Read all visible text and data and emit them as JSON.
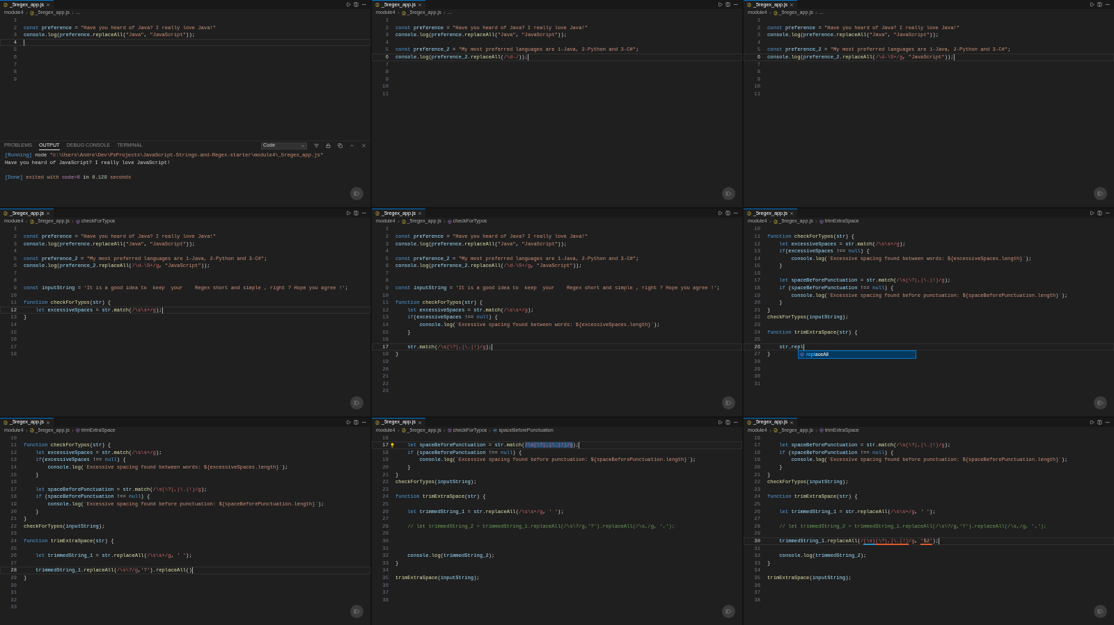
{
  "panels": [
    {
      "tab": {
        "label": "_5regex_app.js"
      },
      "breadcrumb": [
        {
          "kind": "folder",
          "text": "module4"
        },
        {
          "kind": "file",
          "text": "_5regex_app.js"
        },
        {
          "kind": "more",
          "text": "..."
        }
      ],
      "lines": [
        {
          "number": "1",
          "current": false
        },
        {
          "number": "2",
          "current": false,
          "text": "const preference = \"Have you heard of Java? I really love Java!\""
        },
        {
          "number": "3",
          "current": false,
          "text": "console.log(preference.replaceAll(\"Java\", \"JavaScript\"));"
        },
        {
          "number": "4",
          "current": true
        },
        {
          "number": "5",
          "current": false
        },
        {
          "number": "6",
          "current": false
        },
        {
          "number": "7",
          "current": false
        },
        {
          "number": "8",
          "current": false
        },
        {
          "number": "9",
          "current": false
        }
      ],
      "output": {
        "tabs": [
          {
            "label": "PROBLEMS",
            "selected": false
          },
          {
            "label": "OUTPUT",
            "selected": true
          },
          {
            "label": "DEBUG CONSOLE",
            "selected": false
          },
          {
            "label": "TERMINAL",
            "selected": false
          }
        ],
        "channel": "Code",
        "lines": [
          {
            "kind": "text",
            "parts": [
              {
                "kind": "tag",
                "text": "[Running]"
              },
              {
                "kind": "plain",
                "text": " node "
              },
              {
                "kind": "string",
                "text": "\"c:\\Users\\Andre\\Dev\\PsProjects\\JavaScript-Strings-and-Regex-starter\\module4\\_5regex_app.js\""
              }
            ]
          },
          {
            "kind": "text",
            "parts": [
              {
                "kind": "plain",
                "text": "Have you heard of JavaScript? I really love JavaScript!"
              }
            ]
          },
          {
            "kind": "blank"
          },
          {
            "kind": "text",
            "parts": [
              {
                "kind": "tag",
                "text": "[Done]"
              },
              {
                "kind": "string",
                "text": " exited with "
              },
              {
                "kind": "keyword",
                "text": "code=0"
              },
              {
                "kind": "plain",
                "text": " in "
              },
              {
                "kind": "number",
                "text": "0.129"
              },
              {
                "kind": "string",
                "text": " seconds"
              }
            ]
          }
        ]
      }
    },
    {
      "tab": {
        "label": "_5regex_app.js"
      },
      "breadcrumb": [
        {
          "kind": "folder",
          "text": "module4"
        },
        {
          "kind": "file",
          "text": "_5regex_app.js"
        },
        {
          "kind": "more",
          "text": "..."
        }
      ],
      "lines": [
        {
          "number": "1",
          "current": false
        },
        {
          "number": "2",
          "current": false,
          "text": "const preference = \"Have you heard of Java? I really love Java!\""
        },
        {
          "number": "3",
          "current": false,
          "text": "console.log(preference.replaceAll(\"Java\", \"JavaScript\"));"
        },
        {
          "number": "4",
          "current": false
        },
        {
          "number": "5",
          "current": false,
          "text": "const preference_2 = \"My most preferred languages are 1-Java, 2-Python and 3-C#\";"
        },
        {
          "number": "6",
          "current": true,
          "text": "console.log(preference_2.replaceAll(/\\d-/));"
        },
        {
          "number": "7",
          "current": false
        },
        {
          "number": "8",
          "current": false
        },
        {
          "number": "9",
          "current": false
        },
        {
          "number": "10",
          "current": false
        },
        {
          "number": "11",
          "current": false
        }
      ]
    },
    {
      "tab": {
        "label": "_5regex_app.js"
      },
      "breadcrumb": [
        {
          "kind": "folder",
          "text": "module4"
        },
        {
          "kind": "file",
          "text": "_5regex_app.js"
        },
        {
          "kind": "more",
          "text": "..."
        }
      ],
      "lines": [
        {
          "number": "1",
          "current": false
        },
        {
          "number": "2",
          "current": false,
          "text": "const preference = \"Have you heard of Java? I really love Java!\""
        },
        {
          "number": "3",
          "current": false,
          "text": "console.log(preference.replaceAll(\"Java\", \"JavaScript\"));"
        },
        {
          "number": "4",
          "current": false
        },
        {
          "number": "5",
          "current": false,
          "text": "const preference_2 = \"My most preferred languages are 1-Java, 2-Python and 3-C#\";"
        },
        {
          "number": "6",
          "current": true,
          "text": "console.log(preference_2.replaceAll(/\\d-\\S+/g, \"JavaScript\"));"
        },
        {
          "number": "7",
          "current": false
        },
        {
          "number": "8",
          "current": false
        },
        {
          "number": "9",
          "current": false
        },
        {
          "number": "10",
          "current": false
        },
        {
          "number": "11",
          "current": false
        }
      ]
    },
    {
      "tab": {
        "label": "_5regex_app.js"
      },
      "breadcrumb": [
        {
          "kind": "folder",
          "text": "module4"
        },
        {
          "kind": "file",
          "text": "_5regex_app.js"
        },
        {
          "kind": "function",
          "text": "checkForTypos"
        }
      ],
      "lines": [
        {
          "number": "1",
          "current": false
        },
        {
          "number": "2",
          "current": false,
          "text": "const preference = \"Have you heard of Java? I really love Java!\""
        },
        {
          "number": "3",
          "current": false,
          "text": "console.log(preference.replaceAll(\"Java\", \"JavaScript\"));"
        },
        {
          "number": "4",
          "current": false
        },
        {
          "number": "5",
          "current": false,
          "text": "const preference_2 = \"My most preferred languages are 1-Java, 2-Python and 3-C#\";"
        },
        {
          "number": "6",
          "current": false,
          "text": "console.log(preference_2.replaceAll(/\\d-\\S+/g, \"JavaScript\"));"
        },
        {
          "number": "7",
          "current": false
        },
        {
          "number": "8",
          "current": false
        },
        {
          "number": "9",
          "current": false,
          "text": "const inputString = 'It is a good idea to  keep  your    Regex short and simple , right ? Hope you agree !';"
        },
        {
          "number": "10",
          "current": false
        },
        {
          "number": "11",
          "current": false,
          "text": "function checkForTypos(str) {"
        },
        {
          "number": "12",
          "current": true,
          "text": "    let excessiveSpaces = str.match(/\\s\\s+/g);"
        },
        {
          "number": "13",
          "current": false,
          "text": "}"
        },
        {
          "number": "14",
          "current": false
        },
        {
          "number": "15",
          "current": false
        },
        {
          "number": "16",
          "current": false
        },
        {
          "number": "17",
          "current": false
        },
        {
          "number": "18",
          "current": false
        }
      ]
    },
    {
      "tab": {
        "label": "_5regex_app.js"
      },
      "breadcrumb": [
        {
          "kind": "folder",
          "text": "module4"
        },
        {
          "kind": "file",
          "text": "_5regex_app.js"
        },
        {
          "kind": "function",
          "text": "checkForTypos"
        }
      ],
      "lines": [
        {
          "number": "1",
          "current": false
        },
        {
          "number": "2",
          "current": false,
          "text": "const preference = \"Have you heard of Java? I really love Java!\""
        },
        {
          "number": "3",
          "current": false,
          "text": "console.log(preference.replaceAll(\"Java\", \"JavaScript\"));"
        },
        {
          "number": "4",
          "current": false
        },
        {
          "number": "5",
          "current": false,
          "text": "const preference_2 = \"My most preferred languages are 1-Java, 2-Python and 3-C#\";"
        },
        {
          "number": "6",
          "current": false,
          "text": "console.log(preference_2.replaceAll(/\\d-\\S+/g, \"JavaScript\"));"
        },
        {
          "number": "7",
          "current": false
        },
        {
          "number": "8",
          "current": false
        },
        {
          "number": "9",
          "current": false,
          "text": "const inputString = 'It is a good idea to  keep  your    Regex short and simple , right ? Hope you agree !';"
        },
        {
          "number": "10",
          "current": false
        },
        {
          "number": "11",
          "current": false,
          "text": "function checkForTypos(str) {"
        },
        {
          "number": "12",
          "current": false,
          "text": "    let excessiveSpaces = str.match(/\\s\\s+/g);"
        },
        {
          "number": "13",
          "current": false,
          "text": "    if(excessiveSpaces !== null) {"
        },
        {
          "number": "14",
          "current": false,
          "text": "        console.log(`Excessive spacing found between words: ${excessiveSpaces.length}`);"
        },
        {
          "number": "15",
          "current": false,
          "text": "    }"
        },
        {
          "number": "16",
          "current": false
        },
        {
          "number": "17",
          "current": true,
          "text": "    str.match(/\\s(\\?|,|\\.|!)/g);"
        },
        {
          "number": "18",
          "current": false,
          "text": "}"
        },
        {
          "number": "19",
          "current": false
        },
        {
          "number": "20",
          "current": false
        },
        {
          "number": "21",
          "current": false
        },
        {
          "number": "22",
          "current": false
        },
        {
          "number": "23",
          "current": false
        }
      ]
    },
    {
      "tab": {
        "label": "_5regex_app.js"
      },
      "breadcrumb": [
        {
          "kind": "folder",
          "text": "module4"
        },
        {
          "kind": "file",
          "text": "_5regex_app.js"
        },
        {
          "kind": "function",
          "text": "trimExtraSpace"
        }
      ],
      "lines": [
        {
          "number": "10",
          "current": false
        },
        {
          "number": "11",
          "current": false,
          "text": "function checkForTypos(str) {"
        },
        {
          "number": "12",
          "current": false,
          "text": "    let excessiveSpaces = str.match(/\\s\\s+/g);"
        },
        {
          "number": "13",
          "current": false,
          "text": "    if(excessiveSpaces !== null) {"
        },
        {
          "number": "14",
          "current": false,
          "text": "        console.log(`Excessive spacing found between words: ${excessiveSpaces.length}`);"
        },
        {
          "number": "15",
          "current": false,
          "text": "    }"
        },
        {
          "number": "16",
          "current": false
        },
        {
          "number": "17",
          "current": false,
          "text": "    let spaceBeforePunctuation = str.match(/\\s(\\?|,|\\.|!)/g);"
        },
        {
          "number": "18",
          "current": false,
          "text": "    if (spaceBeforePunctuation !== null) {"
        },
        {
          "number": "19",
          "current": false,
          "text": "        console.log(`Excessive spacing found before punctuation: ${spaceBeforePunctuation.length}`);"
        },
        {
          "number": "20",
          "current": false,
          "text": "    }"
        },
        {
          "number": "21",
          "current": false,
          "text": "}"
        },
        {
          "number": "22",
          "current": false,
          "text": "checkForTypos(inputString);"
        },
        {
          "number": "23",
          "current": false
        },
        {
          "number": "24",
          "current": false,
          "text": "function trimExtraSpace(str) {"
        },
        {
          "number": "25",
          "current": false
        },
        {
          "number": "26",
          "current": true,
          "text": "    str.repl",
          "suggestions": [
            {
              "label": "**repl**aceAll",
              "selected": true
            }
          ]
        },
        {
          "number": "27",
          "current": false,
          "text": "}"
        },
        {
          "number": "28",
          "current": false
        },
        {
          "number": "29",
          "current": false
        },
        {
          "number": "30",
          "current": false
        },
        {
          "number": "31",
          "current": false
        }
      ]
    },
    {
      "tab": {
        "label": "_5regex_app.js"
      },
      "breadcrumb": [
        {
          "kind": "folder",
          "text": "module4"
        },
        {
          "kind": "file",
          "text": "_5regex_app.js"
        },
        {
          "kind": "function",
          "text": "trimExtraSpace"
        }
      ],
      "lines": [
        {
          "number": "10",
          "current": false
        },
        {
          "number": "11",
          "current": false,
          "text": "function checkForTypos(str) {"
        },
        {
          "number": "12",
          "current": false,
          "text": "    let excessiveSpaces = str.match(/\\s\\s+/g);"
        },
        {
          "number": "13",
          "current": false,
          "text": "    if(excessiveSpaces !== null) {"
        },
        {
          "number": "14",
          "current": false,
          "text": "        console.log(`Excessive spacing found between words: ${excessiveSpaces.length}`);"
        },
        {
          "number": "15",
          "current": false,
          "text": "    }"
        },
        {
          "number": "16",
          "current": false
        },
        {
          "number": "17",
          "current": false,
          "text": "    let spaceBeforePunctuation = str.match(/\\s(\\?|,|\\.|!)/g);"
        },
        {
          "number": "18",
          "current": false,
          "text": "    if (spaceBeforePunctuation !== null) {"
        },
        {
          "number": "19",
          "current": false,
          "text": "        console.log(`Excessive spacing found before punctuation: ${spaceBeforePunctuation.length}`);"
        },
        {
          "number": "20",
          "current": false,
          "text": "    }"
        },
        {
          "number": "21",
          "current": false,
          "text": "}"
        },
        {
          "number": "22",
          "current": false,
          "text": "checkForTypos(inputString);"
        },
        {
          "number": "23",
          "current": false
        },
        {
          "number": "24",
          "current": false,
          "text": "function trimExtraSpace(str) {"
        },
        {
          "number": "25",
          "current": false
        },
        {
          "number": "26",
          "current": false,
          "text": "    let trimmedString_1 = str.replaceAll(/\\s\\s+/g, ' ');"
        },
        {
          "number": "27",
          "current": false
        },
        {
          "number": "28",
          "current": true,
          "text": "    trimmedString_1.replaceAll(/\\s\\?/g,'?').replaceAll()"
        },
        {
          "number": "29",
          "current": false,
          "text": "}"
        },
        {
          "number": "30",
          "current": false
        },
        {
          "number": "31",
          "current": false
        },
        {
          "number": "32",
          "current": false
        },
        {
          "number": "33",
          "current": false
        }
      ]
    },
    {
      "tab": {
        "label": "_5regex_app.js"
      },
      "breadcrumb": [
        {
          "kind": "folder",
          "text": "module4"
        },
        {
          "kind": "file",
          "text": "_5regex_app.js"
        },
        {
          "kind": "function",
          "text": "checkForTypos"
        },
        {
          "kind": "variable",
          "text": "spaceBeforePunctuation"
        }
      ],
      "lines": [
        {
          "number": "16",
          "current": false
        },
        {
          "number": "17",
          "current": true,
          "lightbulb": true,
          "parts": [
            {
              "text": "    let spaceBeforePunctuation = str.match(",
              "selected": false
            },
            {
              "text": "/\\s(\\?|,|\\.|!)/g",
              "selected": true
            },
            {
              "text": ");",
              "selected": false
            }
          ]
        },
        {
          "number": "18",
          "current": false,
          "text": "    if (spaceBeforePunctuation !== null) {"
        },
        {
          "number": "19",
          "current": false,
          "text": "        console.log(`Excessive spacing found before punctuation: ${spaceBeforePunctuation.length}`);"
        },
        {
          "number": "20",
          "current": false,
          "text": "    }"
        },
        {
          "number": "21",
          "current": false,
          "text": "}"
        },
        {
          "number": "22",
          "current": false,
          "text": "checkForTypos(inputString);"
        },
        {
          "number": "23",
          "current": false
        },
        {
          "number": "24",
          "current": false,
          "text": "function trimExtraSpace(str) {"
        },
        {
          "number": "25",
          "current": false
        },
        {
          "number": "26",
          "current": false,
          "text": "    let trimmedString_1 = str.replaceAll(/\\s\\s+/g, ' ');"
        },
        {
          "number": "27",
          "current": false
        },
        {
          "number": "28",
          "current": false,
          "text": "    // let trimmedString_2 = trimmedString_1.replaceAll(/\\s\\?/g,'?').replaceAll(/\\s,/g, ',');"
        },
        {
          "number": "29",
          "current": false
        },
        {
          "number": "30",
          "current": false
        },
        {
          "number": "31",
          "current": false
        },
        {
          "number": "32",
          "current": false,
          "text": "    console.log(trimmedString_2);"
        },
        {
          "number": "33",
          "current": false,
          "text": "}"
        },
        {
          "number": "34",
          "current": false
        },
        {
          "number": "35",
          "current": false,
          "text": "trimExtraSpace(inputString);"
        },
        {
          "number": "36",
          "current": false
        },
        {
          "number": "37",
          "current": false
        },
        {
          "number": "38",
          "current": false
        }
      ]
    },
    {
      "tab": {
        "label": "_5regex_app.js"
      },
      "breadcrumb": [
        {
          "kind": "folder",
          "text": "module4"
        },
        {
          "kind": "file",
          "text": "_5regex_app.js"
        },
        {
          "kind": "function",
          "text": "trimExtraSpace"
        }
      ],
      "lines": [
        {
          "number": "16",
          "current": false
        },
        {
          "number": "17",
          "current": false,
          "text": "    let spaceBeforePunctuation = str.match(/\\s(\\?|,|\\.|!)/g);"
        },
        {
          "number": "18",
          "current": false,
          "text": "    if (spaceBeforePunctuation !== null) {"
        },
        {
          "number": "19",
          "current": false,
          "text": "        console.log(`Excessive spacing found before punctuation: ${spaceBeforePunctuation.length}`);"
        },
        {
          "number": "20",
          "current": false,
          "text": "    }"
        },
        {
          "number": "21",
          "current": false,
          "text": "}"
        },
        {
          "number": "22",
          "current": false,
          "text": "checkForTypos(inputString);"
        },
        {
          "number": "23",
          "current": false
        },
        {
          "number": "24",
          "current": false,
          "text": "function trimExtraSpace(str) {"
        },
        {
          "number": "25",
          "current": false
        },
        {
          "number": "26",
          "current": false,
          "text": "    let trimmedString_1 = str.replaceAll(/\\s\\s+/g, ' ');"
        },
        {
          "number": "27",
          "current": false
        },
        {
          "number": "28",
          "current": false,
          "text": "    // let trimmedString_2 = trimmedString_1.replaceAll(/\\s\\?/g,'?').replaceAll(/\\s,/g, ',');"
        },
        {
          "number": "29",
          "current": false
        },
        {
          "number": "30",
          "current": true,
          "parts": [
            {
              "text": "    trimmedString_1.replaceAll(/"
            },
            {
              "text": "(\\s)",
              "color": "#2f8fc0"
            },
            {
              "text": "(\\?|,|\\.|!)",
              "color": "#e05a2b"
            },
            {
              "text": "/g, "
            },
            {
              "text": "'$2'",
              "color": "#e05a2b"
            },
            {
              "text": ");"
            }
          ]
        },
        {
          "number": "31",
          "current": false
        },
        {
          "number": "32",
          "current": false,
          "text": "    console.log(trimmedString_2);"
        },
        {
          "number": "33",
          "current": false,
          "text": "}"
        },
        {
          "number": "34",
          "current": false
        },
        {
          "number": "35",
          "current": false,
          "text": "trimExtraSpace(inputString);"
        },
        {
          "number": "36",
          "current": false
        },
        {
          "number": "37",
          "current": false
        },
        {
          "number": "38",
          "current": false
        }
      ]
    }
  ]
}
